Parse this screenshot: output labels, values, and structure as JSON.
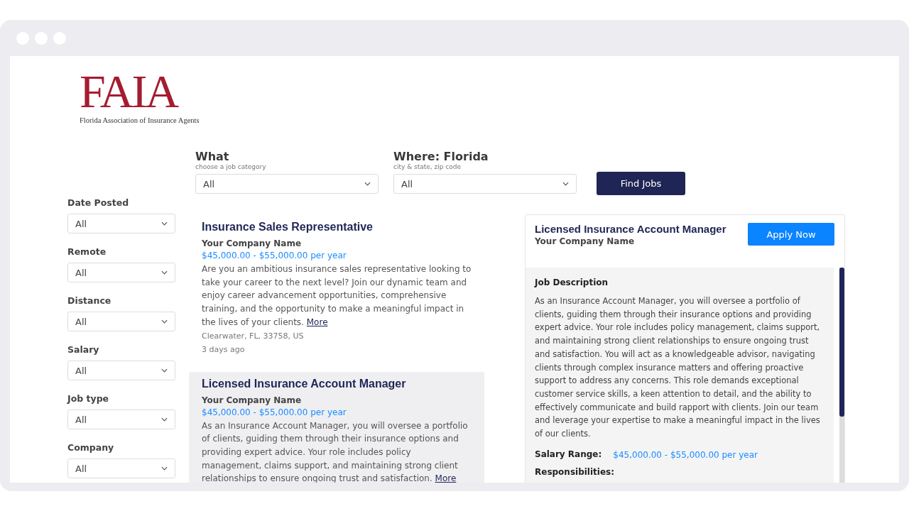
{
  "logo": {
    "mark": "FAIA",
    "tagline": "Florida Association of Insurance Agents"
  },
  "search": {
    "fields": [
      {
        "label": "What",
        "hint": "choose a job category",
        "value": "All"
      },
      {
        "label": "Where: Florida",
        "hint": "city & state, zip code",
        "value": "All"
      }
    ],
    "button": "Find Jobs"
  },
  "filters": [
    {
      "label": "Date Posted",
      "value": "All"
    },
    {
      "label": "Remote",
      "value": "All"
    },
    {
      "label": "Distance",
      "value": "All"
    },
    {
      "label": "Salary",
      "value": "All"
    },
    {
      "label": "Job type",
      "value": "All"
    },
    {
      "label": "Company",
      "value": "All"
    }
  ],
  "jobs": [
    {
      "title": "Insurance Sales Representative",
      "company": "Your Company Name",
      "salary": "$45,000.00 - $55,000.00 per year",
      "description": "Are you an ambitious insurance sales representative looking to take your career to the next level? Join our dynamic team and enjoy career advancement opportunities, comprehensive training, and the opportunity to make a meaningful impact in the lives of your clients.",
      "more": "More",
      "location": "Clearwater, FL, 33758, US",
      "posted": "3 days ago",
      "selected": false
    },
    {
      "title": "Licensed Insurance Account Manager",
      "company": "Your Company Name",
      "salary": "$45,000.00 - $55,000.00 per year",
      "description": "As an Insurance Account Manager, you will oversee a portfolio of clients, guiding them through their insurance options and providing expert advice. Your role includes policy management, claims support, and maintaining strong client relationships to ensure ongoing trust and satisfaction.",
      "more": "More",
      "selected": true
    }
  ],
  "detail": {
    "title": "Licensed Insurance Account Manager",
    "company": "Your Company Name",
    "apply": "Apply Now",
    "section_title": "Job Description",
    "description": "As an Insurance Account Manager, you will oversee a portfolio of clients, guiding them through their insurance options and providing expert advice. Your role includes policy management, claims support, and maintaining strong client relationships to ensure ongoing trust and satisfaction. You will act as a knowledgeable advisor, navigating clients through complex insurance matters and offering proactive support to address any concerns. This role demands exceptional customer service skills, a keen attention to detail, and the ability to effectively communicate and build rapport with clients. Join our team and leverage your expertise to make a meaningful impact in the lives of our clients.",
    "salary_label": "Salary Range:",
    "salary": "$45,000.00 - $55,000.00 per year",
    "next_heading": "Responsibilities:"
  }
}
